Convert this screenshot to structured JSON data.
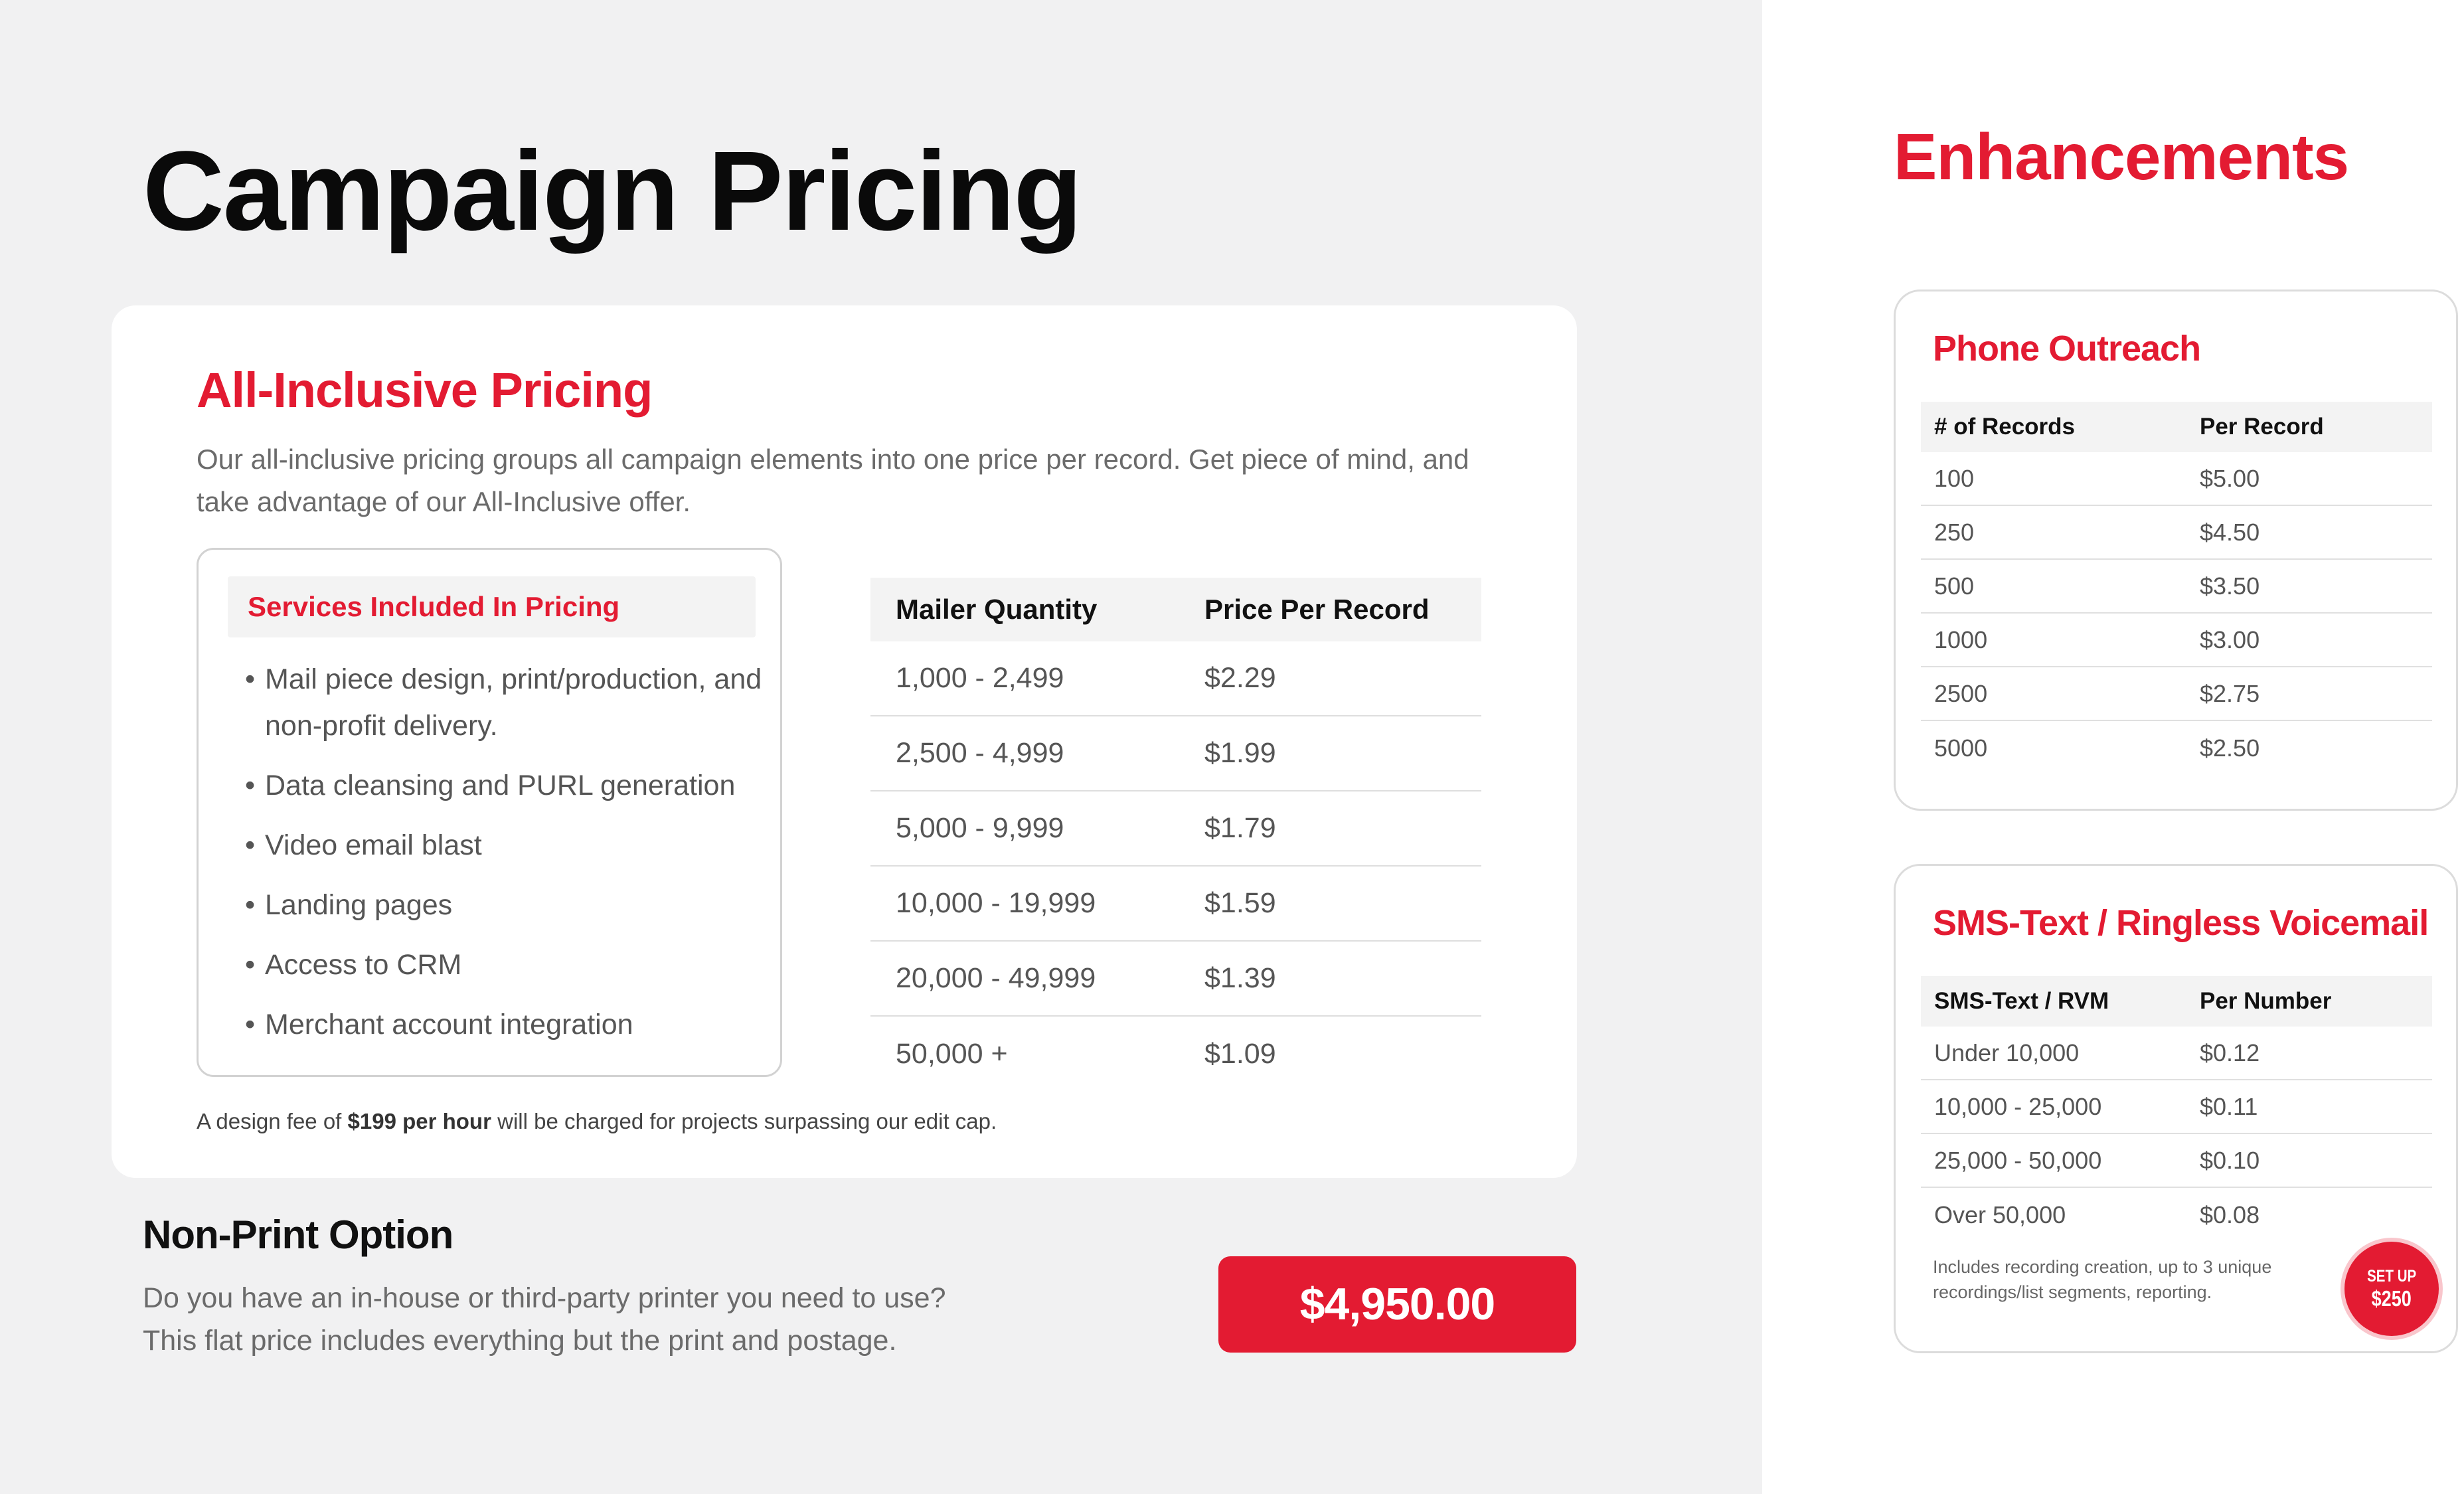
{
  "page_title": "Campaign Pricing",
  "all_inclusive": {
    "title": "All-Inclusive Pricing",
    "description": "Our all-inclusive pricing groups all campaign elements into one price per record. Get piece of mind, and take advantage of our All-Inclusive offer.",
    "services": {
      "header": "Services Included In Pricing",
      "items": [
        "Mail piece design, print/production, and non-profit delivery.",
        "Data cleansing and PURL generation",
        "Video email blast",
        "Landing pages",
        "Access to CRM",
        "Merchant account integration"
      ]
    },
    "price_table": {
      "headers": [
        "Mailer Quantity",
        "Price Per Record"
      ],
      "rows": [
        [
          "1,000 - 2,499",
          "$2.29"
        ],
        [
          "2,500 - 4,999",
          "$1.99"
        ],
        [
          "5,000 - 9,999",
          "$1.79"
        ],
        [
          "10,000 - 19,999",
          "$1.59"
        ],
        [
          "20,000 - 49,999",
          "$1.39"
        ],
        [
          "50,000 +",
          "$1.09"
        ]
      ]
    },
    "design_note": {
      "prefix": "A design fee of ",
      "bold": "$199 per hour",
      "suffix": " will be charged for projects surpassing our edit cap."
    }
  },
  "non_print": {
    "title": "Non-Print Option",
    "line1": "Do you have an in-house or third-party printer you need to use?",
    "line2": "This flat price includes everything but the print and postage.",
    "price": "$4,950.00"
  },
  "enhancements": {
    "title": "Enhancements",
    "phone": {
      "title": "Phone Outreach",
      "headers": [
        "# of Records",
        "Per Record"
      ],
      "rows": [
        [
          "100",
          "$5.00"
        ],
        [
          "250",
          "$4.50"
        ],
        [
          "500",
          "$3.50"
        ],
        [
          "1000",
          "$3.00"
        ],
        [
          "2500",
          "$2.75"
        ],
        [
          "5000",
          "$2.50"
        ]
      ]
    },
    "sms": {
      "title": "SMS-Text / Ringless Voicemail",
      "headers": [
        "SMS-Text / RVM",
        "Per Number"
      ],
      "rows": [
        [
          "Under 10,000",
          "$0.12"
        ],
        [
          "10,000 - 25,000",
          "$0.11"
        ],
        [
          "25,000 - 50,000",
          "$0.10"
        ],
        [
          "Over 50,000",
          "$0.08"
        ]
      ],
      "note": "Includes recording creation, up to 3 unique recordings/list segments, reporting.",
      "badge_line1": "SET UP",
      "badge_line2": "$250"
    }
  },
  "colors": {
    "accent_red": "#e31b32",
    "background_gray": "#f1f1f2"
  }
}
